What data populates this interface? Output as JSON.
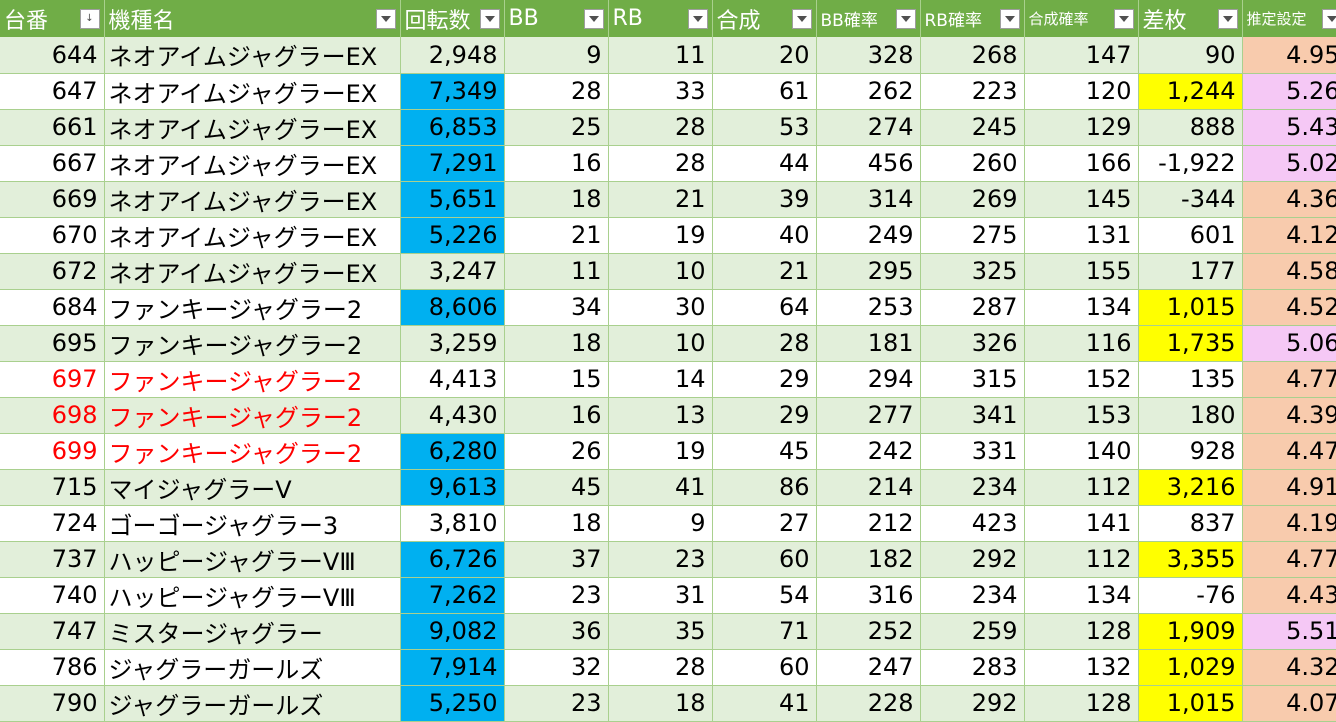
{
  "headers": [
    {
      "label": "台番",
      "filter": "sort"
    },
    {
      "label": "機種名",
      "filter": "dropdown"
    },
    {
      "label": "回転数",
      "filter": "dropdown"
    },
    {
      "label": "BB",
      "filter": "dropdown"
    },
    {
      "label": "RB",
      "filter": "dropdown"
    },
    {
      "label": "合成",
      "filter": "dropdown"
    },
    {
      "label": "BB確率",
      "filter": "dropdown"
    },
    {
      "label": "RB確率",
      "filter": "dropdown"
    },
    {
      "label": "合成確率",
      "filter": "dropdown"
    },
    {
      "label": "差枚",
      "filter": "dropdown"
    },
    {
      "label": "推定設定",
      "filter": "dropdown"
    }
  ],
  "colors": {
    "header_bg": "#70AD47",
    "band": "#E2EFDA",
    "spins_highlight": "#00B0F0",
    "payout_highlight": "#FFFF00",
    "setting_orange": "#F8CBAD",
    "setting_pink": "#F5C8F5",
    "red_text": "#FF0000"
  },
  "rows": [
    {
      "no": "644",
      "model": "ネオアイムジャグラーEX",
      "spins": "2,948",
      "bb": "9",
      "rb": "11",
      "total": "20",
      "bb_rate": "328",
      "rb_rate": "268",
      "total_rate": "147",
      "diff": "90",
      "setting": "4.95",
      "spins_hl": false,
      "diff_hl": false,
      "setting_color": "orange",
      "red": false
    },
    {
      "no": "647",
      "model": "ネオアイムジャグラーEX",
      "spins": "7,349",
      "bb": "28",
      "rb": "33",
      "total": "61",
      "bb_rate": "262",
      "rb_rate": "223",
      "total_rate": "120",
      "diff": "1,244",
      "setting": "5.26",
      "spins_hl": true,
      "diff_hl": true,
      "setting_color": "pink",
      "red": false
    },
    {
      "no": "661",
      "model": "ネオアイムジャグラーEX",
      "spins": "6,853",
      "bb": "25",
      "rb": "28",
      "total": "53",
      "bb_rate": "274",
      "rb_rate": "245",
      "total_rate": "129",
      "diff": "888",
      "setting": "5.43",
      "spins_hl": true,
      "diff_hl": false,
      "setting_color": "pink",
      "red": false
    },
    {
      "no": "667",
      "model": "ネオアイムジャグラーEX",
      "spins": "7,291",
      "bb": "16",
      "rb": "28",
      "total": "44",
      "bb_rate": "456",
      "rb_rate": "260",
      "total_rate": "166",
      "diff": "-1,922",
      "setting": "5.02",
      "spins_hl": true,
      "diff_hl": false,
      "setting_color": "pink",
      "red": false
    },
    {
      "no": "669",
      "model": "ネオアイムジャグラーEX",
      "spins": "5,651",
      "bb": "18",
      "rb": "21",
      "total": "39",
      "bb_rate": "314",
      "rb_rate": "269",
      "total_rate": "145",
      "diff": "-344",
      "setting": "4.36",
      "spins_hl": true,
      "diff_hl": false,
      "setting_color": "orange",
      "red": false
    },
    {
      "no": "670",
      "model": "ネオアイムジャグラーEX",
      "spins": "5,226",
      "bb": "21",
      "rb": "19",
      "total": "40",
      "bb_rate": "249",
      "rb_rate": "275",
      "total_rate": "131",
      "diff": "601",
      "setting": "4.12",
      "spins_hl": true,
      "diff_hl": false,
      "setting_color": "orange",
      "red": false
    },
    {
      "no": "672",
      "model": "ネオアイムジャグラーEX",
      "spins": "3,247",
      "bb": "11",
      "rb": "10",
      "total": "21",
      "bb_rate": "295",
      "rb_rate": "325",
      "total_rate": "155",
      "diff": "177",
      "setting": "4.58",
      "spins_hl": false,
      "diff_hl": false,
      "setting_color": "orange",
      "red": false
    },
    {
      "no": "684",
      "model": "ファンキージャグラー2",
      "spins": "8,606",
      "bb": "34",
      "rb": "30",
      "total": "64",
      "bb_rate": "253",
      "rb_rate": "287",
      "total_rate": "134",
      "diff": "1,015",
      "setting": "4.52",
      "spins_hl": true,
      "diff_hl": true,
      "setting_color": "orange",
      "red": false
    },
    {
      "no": "695",
      "model": "ファンキージャグラー2",
      "spins": "3,259",
      "bb": "18",
      "rb": "10",
      "total": "28",
      "bb_rate": "181",
      "rb_rate": "326",
      "total_rate": "116",
      "diff": "1,735",
      "setting": "5.06",
      "spins_hl": false,
      "diff_hl": true,
      "setting_color": "pink",
      "red": false
    },
    {
      "no": "697",
      "model": "ファンキージャグラー2",
      "spins": "4,413",
      "bb": "15",
      "rb": "14",
      "total": "29",
      "bb_rate": "294",
      "rb_rate": "315",
      "total_rate": "152",
      "diff": "135",
      "setting": "4.77",
      "spins_hl": false,
      "diff_hl": false,
      "setting_color": "orange",
      "red": true
    },
    {
      "no": "698",
      "model": "ファンキージャグラー2",
      "spins": "4,430",
      "bb": "16",
      "rb": "13",
      "total": "29",
      "bb_rate": "277",
      "rb_rate": "341",
      "total_rate": "153",
      "diff": "180",
      "setting": "4.39",
      "spins_hl": false,
      "diff_hl": false,
      "setting_color": "orange",
      "red": true
    },
    {
      "no": "699",
      "model": "ファンキージャグラー2",
      "spins": "6,280",
      "bb": "26",
      "rb": "19",
      "total": "45",
      "bb_rate": "242",
      "rb_rate": "331",
      "total_rate": "140",
      "diff": "928",
      "setting": "4.47",
      "spins_hl": true,
      "diff_hl": false,
      "setting_color": "orange",
      "red": true
    },
    {
      "no": "715",
      "model": "マイジャグラーV",
      "spins": "9,613",
      "bb": "45",
      "rb": "41",
      "total": "86",
      "bb_rate": "214",
      "rb_rate": "234",
      "total_rate": "112",
      "diff": "3,216",
      "setting": "4.91",
      "spins_hl": true,
      "diff_hl": true,
      "setting_color": "orange",
      "red": false
    },
    {
      "no": "724",
      "model": "ゴーゴージャグラー3",
      "spins": "3,810",
      "bb": "18",
      "rb": "9",
      "total": "27",
      "bb_rate": "212",
      "rb_rate": "423",
      "total_rate": "141",
      "diff": "837",
      "setting": "4.19",
      "spins_hl": false,
      "diff_hl": false,
      "setting_color": "orange",
      "red": false
    },
    {
      "no": "737",
      "model": "ハッピージャグラーVⅢ",
      "spins": "6,726",
      "bb": "37",
      "rb": "23",
      "total": "60",
      "bb_rate": "182",
      "rb_rate": "292",
      "total_rate": "112",
      "diff": "3,355",
      "setting": "4.77",
      "spins_hl": true,
      "diff_hl": true,
      "setting_color": "orange",
      "red": false
    },
    {
      "no": "740",
      "model": "ハッピージャグラーVⅢ",
      "spins": "7,262",
      "bb": "23",
      "rb": "31",
      "total": "54",
      "bb_rate": "316",
      "rb_rate": "234",
      "total_rate": "134",
      "diff": "-76",
      "setting": "4.43",
      "spins_hl": true,
      "diff_hl": false,
      "setting_color": "orange",
      "red": false
    },
    {
      "no": "747",
      "model": "ミスタージャグラー",
      "spins": "9,082",
      "bb": "36",
      "rb": "35",
      "total": "71",
      "bb_rate": "252",
      "rb_rate": "259",
      "total_rate": "128",
      "diff": "1,909",
      "setting": "5.51",
      "spins_hl": true,
      "diff_hl": true,
      "setting_color": "pink",
      "red": false
    },
    {
      "no": "786",
      "model": "ジャグラーガールズ",
      "spins": "7,914",
      "bb": "32",
      "rb": "28",
      "total": "60",
      "bb_rate": "247",
      "rb_rate": "283",
      "total_rate": "132",
      "diff": "1,029",
      "setting": "4.32",
      "spins_hl": true,
      "diff_hl": true,
      "setting_color": "orange",
      "red": false
    },
    {
      "no": "790",
      "model": "ジャグラーガールズ",
      "spins": "5,250",
      "bb": "23",
      "rb": "18",
      "total": "41",
      "bb_rate": "228",
      "rb_rate": "292",
      "total_rate": "128",
      "diff": "1,015",
      "setting": "4.07",
      "spins_hl": true,
      "diff_hl": true,
      "setting_color": "orange",
      "red": false
    }
  ]
}
